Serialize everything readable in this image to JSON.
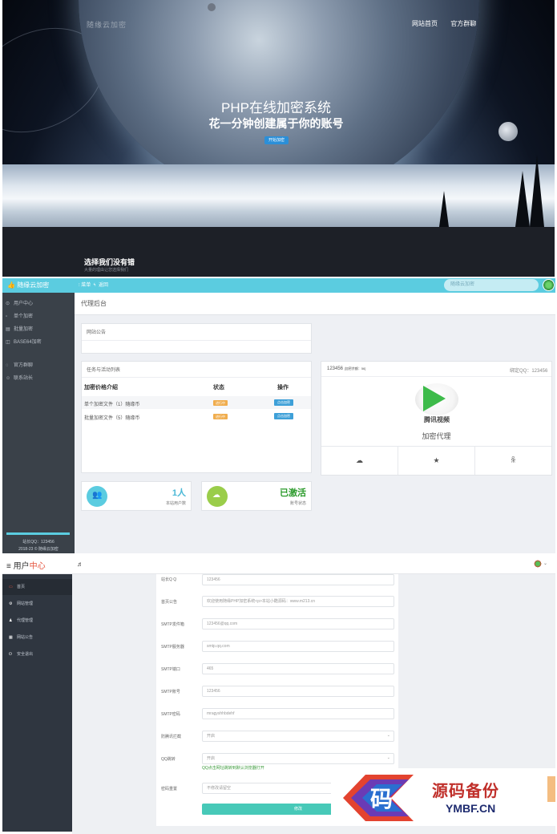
{
  "hero": {
    "logo_text": "随缘云加密",
    "nav": [
      "网站首页",
      "官方群聊"
    ],
    "title": "PHP在线加密系统",
    "subtitle": "花一分钟创建属于你的账号",
    "cta": "开始加密"
  },
  "band": {
    "title": "选择我们没有错",
    "subtitle": "大量的理由让您选择我们"
  },
  "dashboard": {
    "brand": "随缘云加密",
    "topbar_menu": [
      "菜单",
      "返回"
    ],
    "search_placeholder": "随缘云加密",
    "sidebar": [
      "用户中心",
      "单个加密",
      "批量加密",
      "BASE64加密",
      "官方群聊",
      "联系站长"
    ],
    "sidebar_footer": [
      "站长QQ：123456",
      "2018-23 © 随缘云加密"
    ],
    "page_title": "代理后台",
    "notice_title": "网站公告",
    "tasks_title": "任务与活动列表",
    "table_headers": [
      "加密价格介绍",
      "状态",
      "操作"
    ],
    "rows": [
      {
        "name": "单个加密文件（1）随缘币",
        "status": "进行中",
        "action": "点击加密"
      },
      {
        "name": "批量加密文件（5）随缘币",
        "status": "进行中",
        "action": "点击加密"
      }
    ],
    "stat_users": {
      "value": "1人",
      "label": "本站用户数"
    },
    "stat_account": {
      "value": "已激活",
      "label": "账号状态"
    },
    "agent": {
      "id": "123456",
      "balance": "[加密余额：56]",
      "bind_qq": "绑定QQ：123456",
      "logo_caption": "腾讯视频",
      "label": "加密代理"
    },
    "accent": "#5bcce0"
  },
  "admin": {
    "title_a": "用户",
    "title_b": "中心",
    "music_icon": "♬",
    "sidebar": [
      "首页",
      "网站管理",
      "代理管理",
      "网站公告",
      "安全退出"
    ],
    "fields": [
      {
        "label": "站长Q Q",
        "value": "123456",
        "type": "text"
      },
      {
        "label": "首页公告",
        "value": "欢迎使用随缘PHP加密系统<p>本站小酷源码：www.m213.cn",
        "type": "text"
      },
      {
        "label": "SMTP发件箱",
        "value": "123456@qq.com",
        "type": "text"
      },
      {
        "label": "SMTP服务器",
        "value": "smtp.qq.com",
        "type": "text"
      },
      {
        "label": "SMTP端口",
        "value": "465",
        "type": "text"
      },
      {
        "label": "SMTP账号",
        "value": "123456",
        "type": "text"
      },
      {
        "label": "SMTP密码",
        "value": "mragyshhbdehf",
        "type": "text"
      },
      {
        "label": "防腾讯拦截",
        "value": "开启",
        "type": "select"
      },
      {
        "label": "QQ跳转",
        "value": "开启",
        "type": "select"
      },
      {
        "label": "密码重置",
        "value": "不修改请留空",
        "type": "text"
      }
    ],
    "qq_hint": "QQ点击网址跳转到默认浏览器打开",
    "submit": "修改"
  },
  "watermark": {
    "emblem_char": "码",
    "text": "源码备份",
    "url": "YMBF.CN"
  }
}
